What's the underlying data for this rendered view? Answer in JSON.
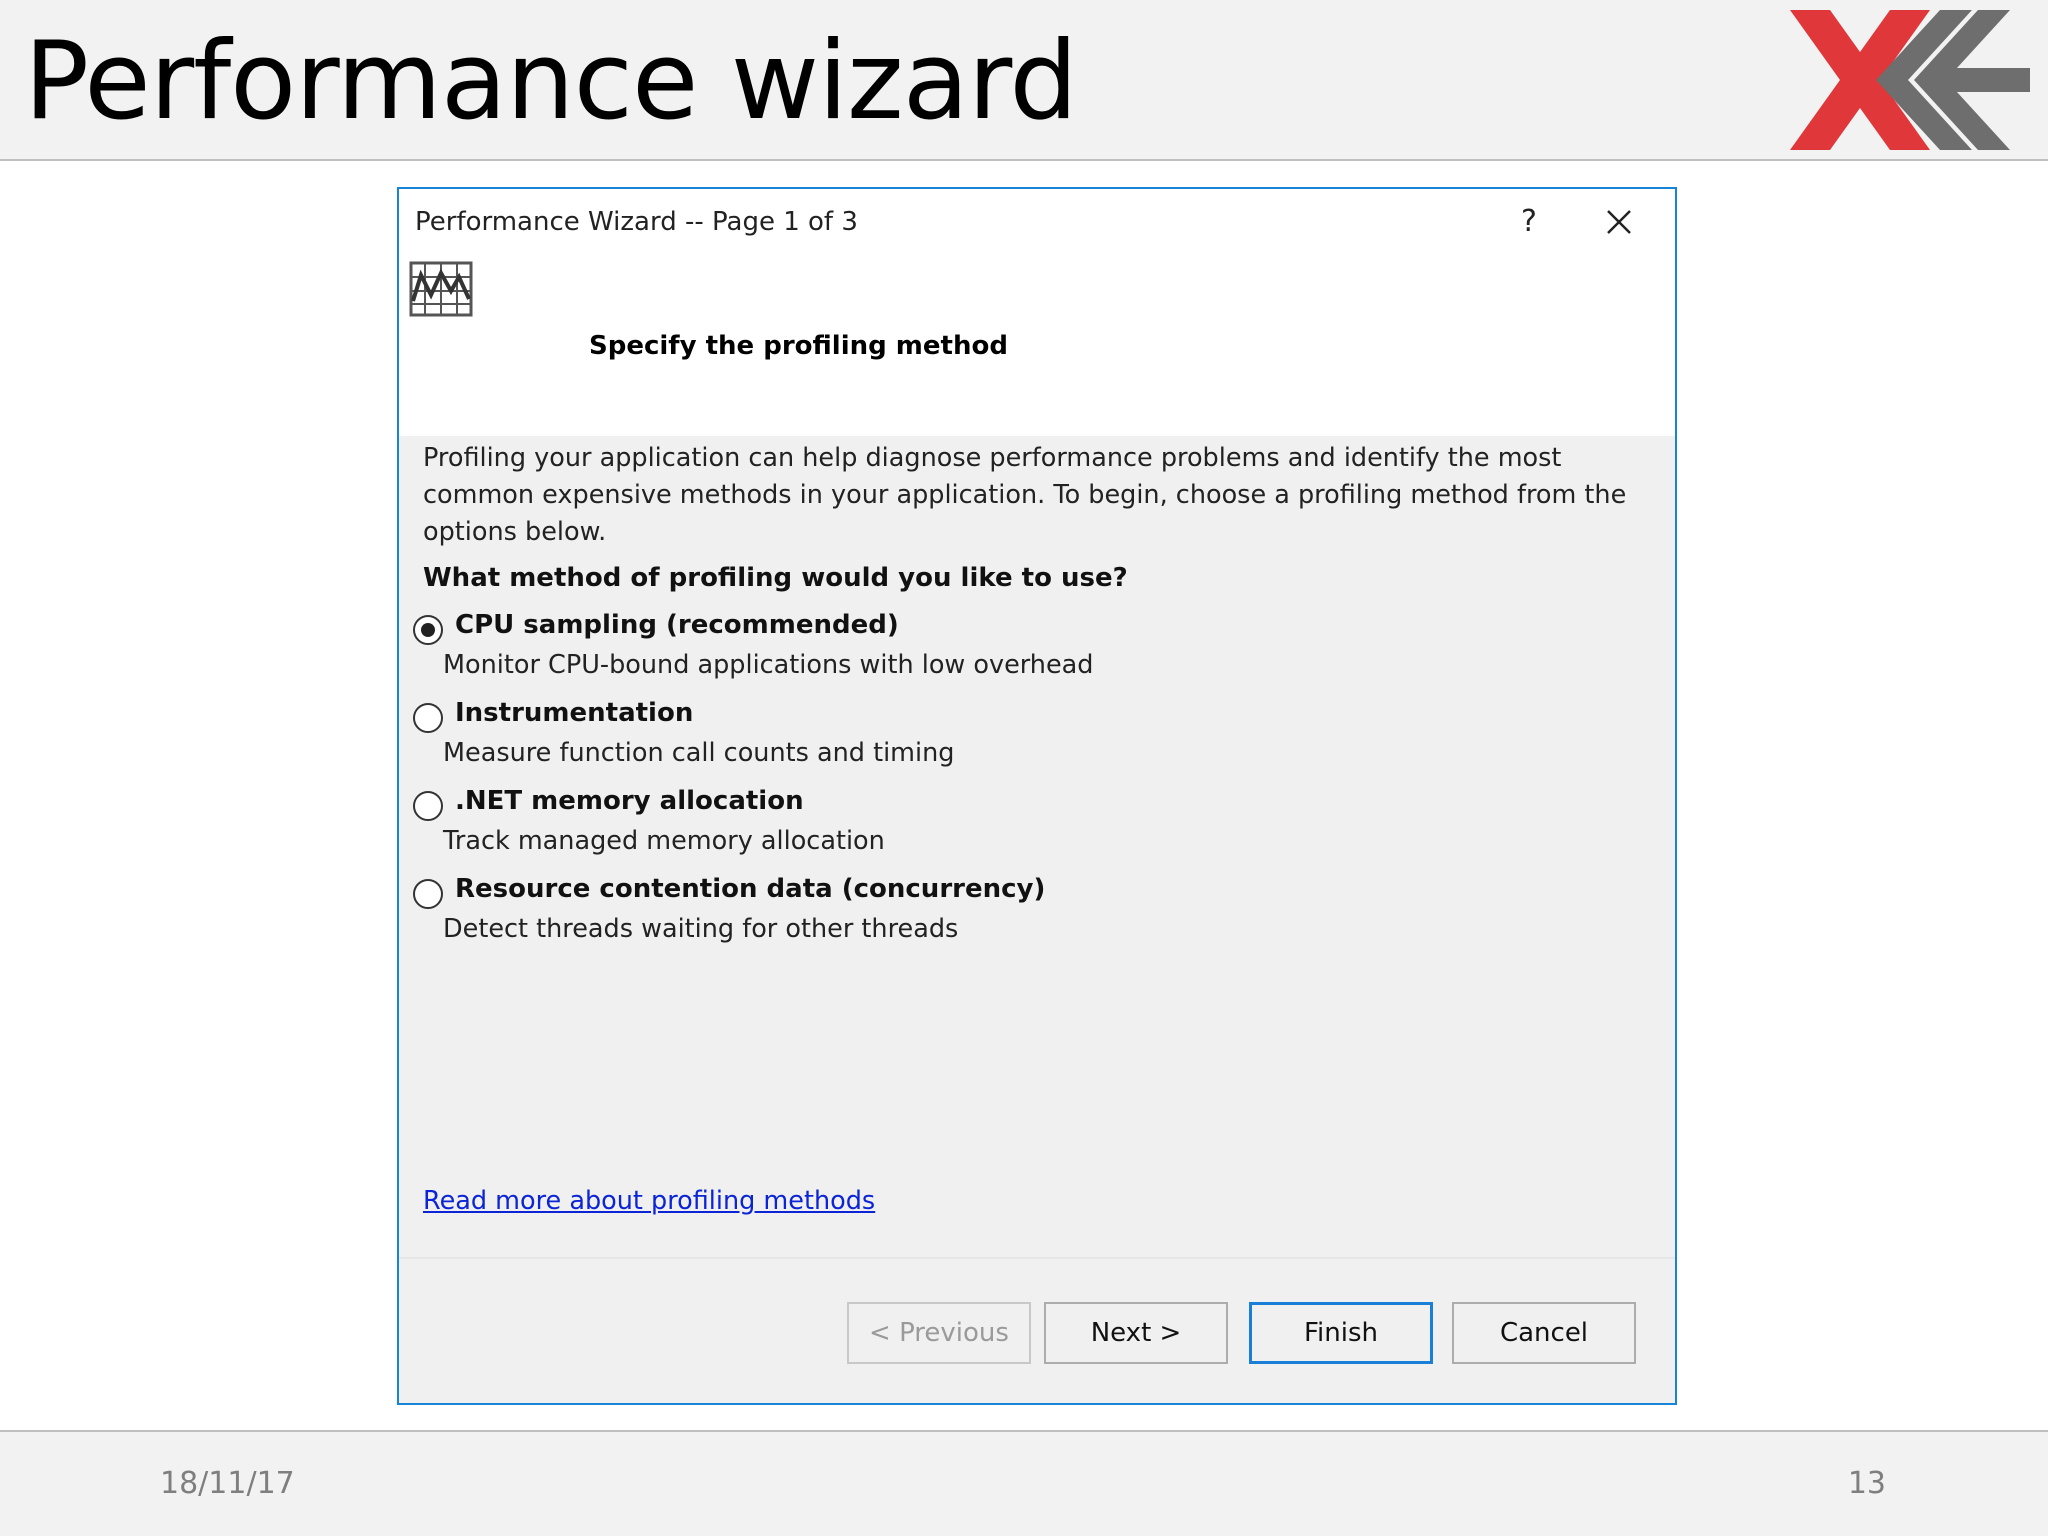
{
  "slide": {
    "title": "Performance wizard",
    "footer_date": "18/11/17",
    "page_number": "13",
    "logo_colors": {
      "red": "#e0373a",
      "gray": "#6e6e6e"
    }
  },
  "dialog": {
    "title": "Performance Wizard -- Page 1 of 3",
    "help_label": "?",
    "heading": "Specify the profiling method",
    "intro": "Profiling your application can help diagnose performance problems and identify the most common expensive methods in your application. To begin, choose a profiling method from the options below.",
    "question": "What method of profiling would you like to use?",
    "options": [
      {
        "label": "CPU sampling (recommended)",
        "description": "Monitor CPU-bound applications with low overhead",
        "selected": true
      },
      {
        "label": "Instrumentation",
        "description": "Measure function call counts and timing",
        "selected": false
      },
      {
        "label": ".NET memory allocation",
        "description": "Track managed memory allocation",
        "selected": false
      },
      {
        "label": "Resource contention data (concurrency)",
        "description": "Detect threads waiting for other threads",
        "selected": false
      }
    ],
    "read_more_link": "Read more about profiling methods",
    "buttons": {
      "previous": "< Previous",
      "next": "Next >",
      "finish": "Finish",
      "cancel": "Cancel"
    },
    "accent_color": "#1883d7"
  }
}
